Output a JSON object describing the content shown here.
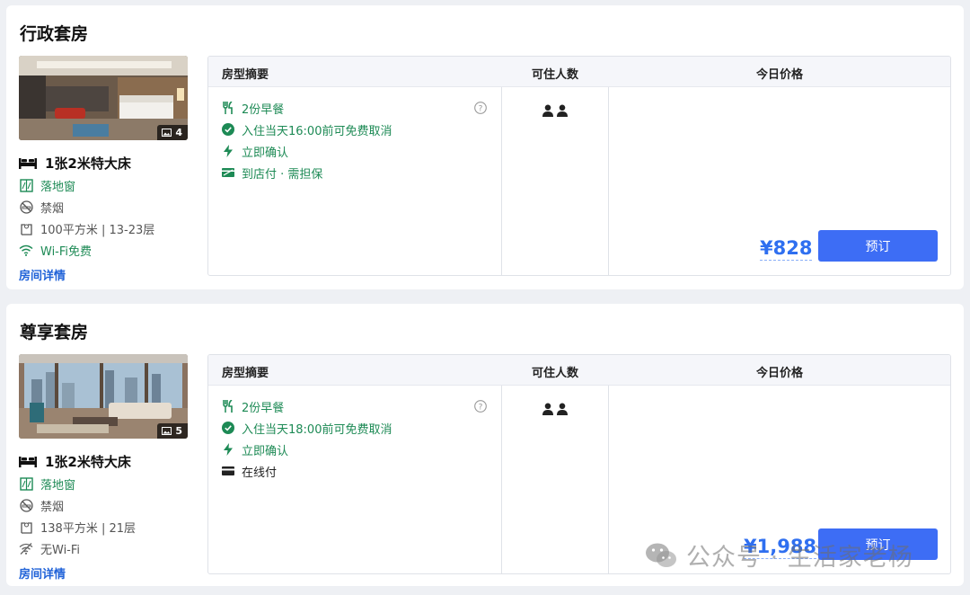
{
  "rooms": [
    {
      "title": "行政套房",
      "photo_count": "4",
      "bed": "1张2米特大床",
      "window": "落地窗",
      "smoking": "禁烟",
      "area_floor": "100平方米 | 13-23层",
      "wifi": "Wi-Fi免费",
      "details_link": "房间详情",
      "table": {
        "headers": [
          "房型摘要",
          "可住人数",
          "今日价格"
        ],
        "breakfast": "2份早餐",
        "cancel": "入住当天16:00前可免费取消",
        "confirm": "立即确认",
        "payment": "到店付 · 需担保",
        "price": "¥828",
        "book_label": "预订"
      }
    },
    {
      "title": "尊享套房",
      "photo_count": "5",
      "bed": "1张2米特大床",
      "window": "落地窗",
      "smoking": "禁烟",
      "area_floor": "138平方米 | 21层",
      "wifi": "无Wi-Fi",
      "details_link": "房间详情",
      "table": {
        "headers": [
          "房型摘要",
          "可住人数",
          "今日价格"
        ],
        "breakfast": "2份早餐",
        "cancel": "入住当天18:00前可免费取消",
        "confirm": "立即确认",
        "payment": "在线付",
        "price": "¥1,988",
        "book_label": "预订"
      }
    }
  ],
  "watermark": "公众号 · 生活家老杨",
  "colors": {
    "accent": "#3d6df5",
    "price": "#2f6ff0",
    "green": "#1d8a55",
    "link": "#2163d8"
  },
  "icons": [
    "bed-icon",
    "window-icon",
    "no-smoking-icon",
    "area-icon",
    "wifi-icon",
    "no-wifi-icon",
    "breakfast-icon",
    "check-icon",
    "lightning-icon",
    "pay-at-hotel-icon",
    "card-icon",
    "help-icon",
    "person-icon",
    "image-icon",
    "wechat-icon"
  ]
}
